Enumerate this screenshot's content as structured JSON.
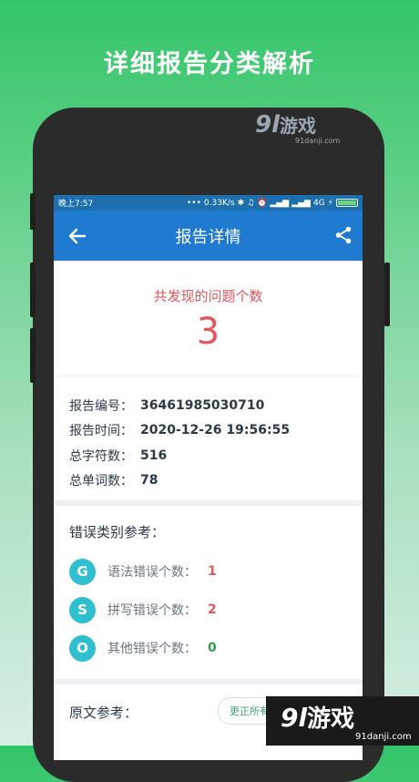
{
  "promo": {
    "title": "详细报告分类解析"
  },
  "watermark": {
    "top_logo": "9l",
    "top_cn": "游戏",
    "top_url": "91danji.com",
    "bottom_logo": "9l",
    "bottom_cn": "游戏",
    "bottom_url": "91danji.com"
  },
  "status_bar": {
    "time": "晚上7:57",
    "speed": "0.33K/s",
    "network": "4G"
  },
  "app_bar": {
    "title": "报告详情"
  },
  "summary": {
    "label": "共发现的问题个数",
    "count": "3"
  },
  "info": [
    {
      "key": "报告编号：",
      "value": "36461985030710"
    },
    {
      "key": "报告时间：",
      "value": "2020-12-26 19:56:55"
    },
    {
      "key": "总字符数：",
      "value": "516"
    },
    {
      "key": "总单词数：",
      "value": "78"
    }
  ],
  "errors": {
    "title": "错误类别参考：",
    "items": [
      {
        "letter": "G",
        "label": "语法错误个数：",
        "value": "1",
        "color": "#e1575c"
      },
      {
        "letter": "S",
        "label": "拼写错误个数：",
        "value": "2",
        "color": "#e1575c"
      },
      {
        "letter": "O",
        "label": "其他错误个数：",
        "value": "0",
        "color": "#2e9e4f"
      }
    ]
  },
  "original": {
    "title": "原文参考：",
    "fix_all_label": "更正所有"
  },
  "colors": {
    "accent": "#1f7ad0",
    "danger": "#e1575c",
    "success": "#2e9e4f",
    "badge": "#2fbfd0"
  }
}
